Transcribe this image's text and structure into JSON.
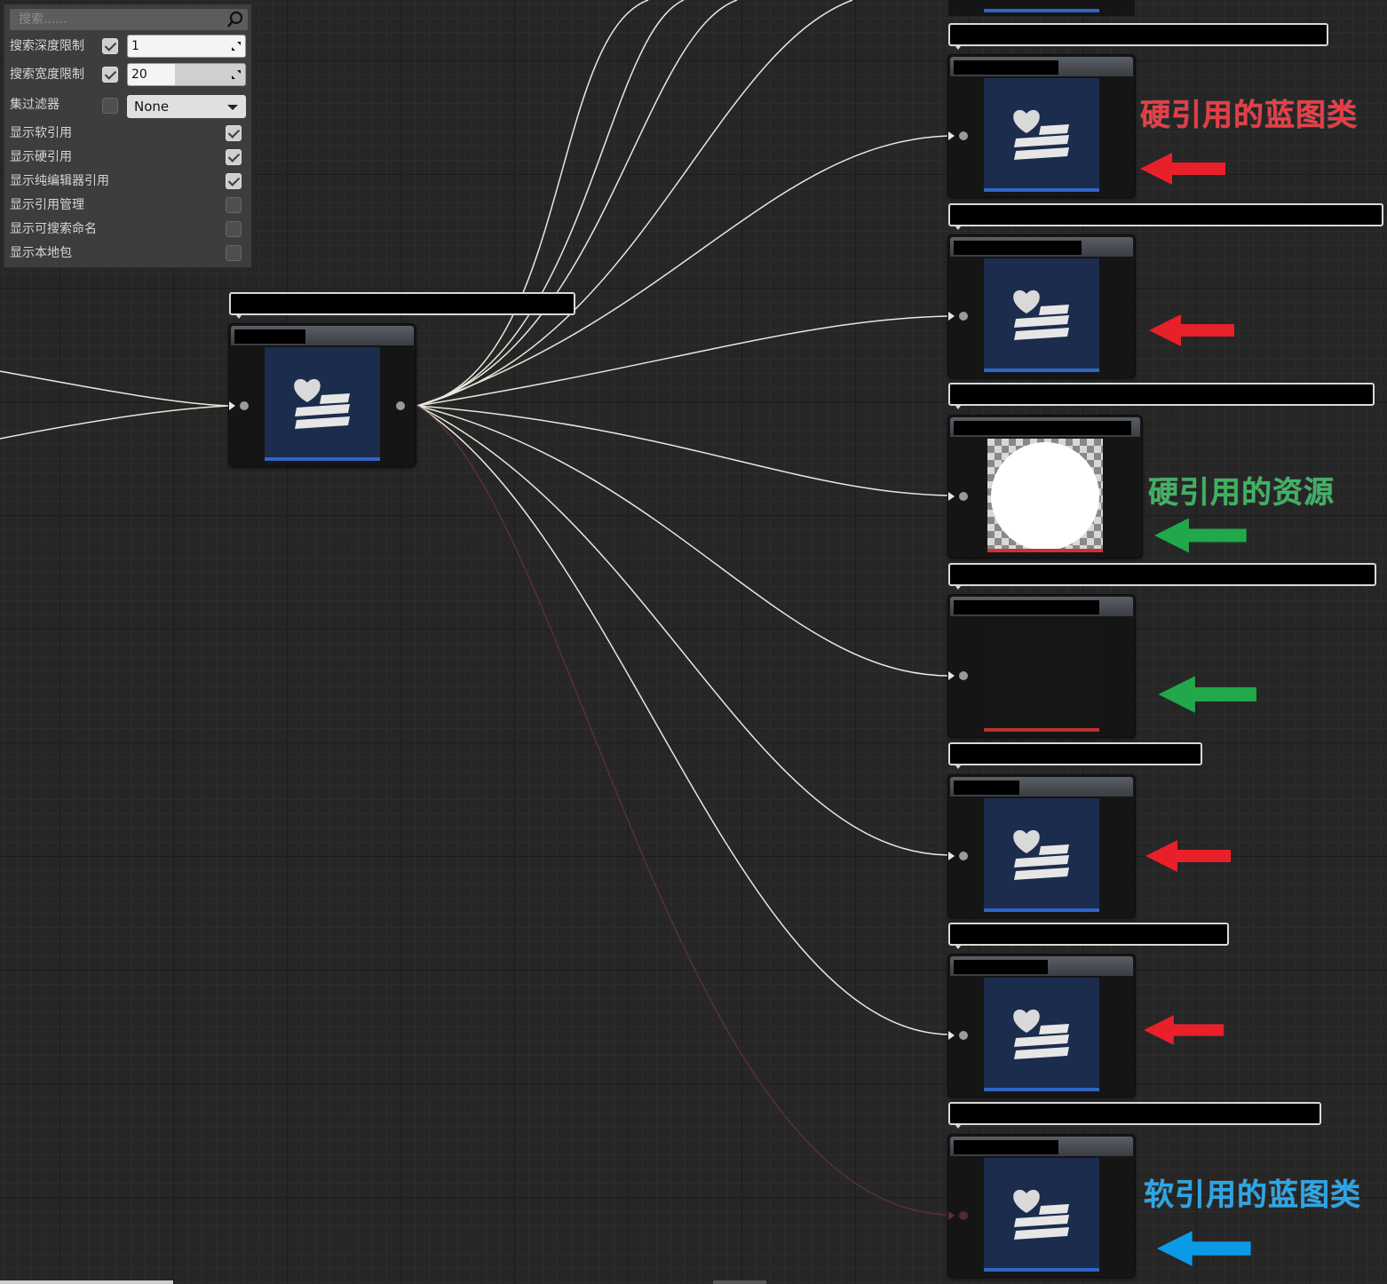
{
  "options_panel": {
    "search_placeholder": "搜索......",
    "depth_label": "搜索深度限制",
    "depth_checked": true,
    "depth_value": "1",
    "breadth_label": "搜索宽度限制",
    "breadth_checked": true,
    "breadth_value": "20",
    "breadth_fill_fraction": 0.4,
    "collection_filter_label": "集过滤器",
    "collection_filter_checked": false,
    "collection_filter_value": "None",
    "toggles": [
      {
        "label": "显示软引用",
        "checked": true
      },
      {
        "label": "显示硬引用",
        "checked": true
      },
      {
        "label": "显示纯编辑器引用",
        "checked": true
      },
      {
        "label": "显示引用管理",
        "checked": false
      },
      {
        "label": "显示可搜索命名",
        "checked": false
      },
      {
        "label": "显示本地包",
        "checked": false
      }
    ]
  },
  "annotations": {
    "hard_blueprint": "硬引用的蓝图类",
    "hard_asset": "硬引用的资源",
    "soft_blueprint": "软引用的蓝图类",
    "colors": {
      "red": "#e8202a",
      "green": "#21a84a",
      "blue": "#0b9be6"
    }
  },
  "nodes": [
    {
      "kind": "blueprint",
      "reference": "root"
    },
    {
      "kind": "blueprint",
      "reference": "hard"
    },
    {
      "kind": "blueprint",
      "reference": "hard"
    },
    {
      "kind": "texture",
      "reference": "hard"
    },
    {
      "kind": "material",
      "reference": "hard"
    },
    {
      "kind": "blueprint",
      "reference": "hard"
    },
    {
      "kind": "blueprint",
      "reference": "hard"
    },
    {
      "kind": "blueprint",
      "reference": "soft"
    }
  ],
  "icons": [
    "search-icon",
    "blueprint-heart-icon",
    "checkbox-icon",
    "dropdown-arrow-icon"
  ]
}
